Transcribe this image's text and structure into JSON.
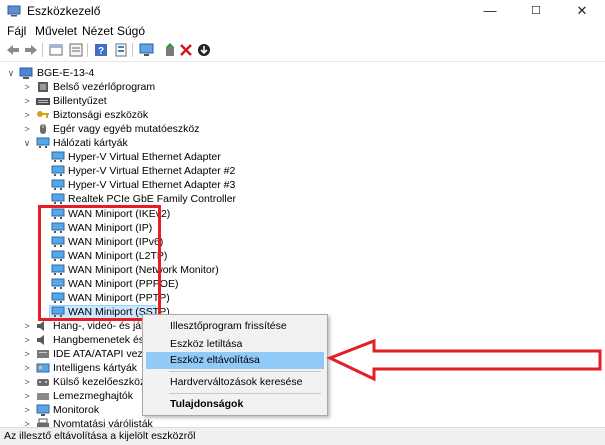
{
  "window": {
    "title": "Eszközkezelő",
    "controls": {
      "minimize": "—",
      "maximize": "☐",
      "close": "✕"
    }
  },
  "menu": [
    "Fájl",
    "Művelet",
    "Nézet",
    "Súgó"
  ],
  "toolbar": [
    "back-arrow-icon",
    "forward-arrow-icon",
    "properties-icon",
    "show-hide-icon",
    "help-icon",
    "device-list-icon",
    "monitor-icon",
    "add-driver-icon",
    "remove-x-icon",
    "update-download-icon"
  ],
  "tree": {
    "root": "BGE-E-13-4",
    "items": [
      {
        "label": "Belső vezérlőprogram",
        "expanded": false
      },
      {
        "label": "Billentyűzet",
        "expanded": false
      },
      {
        "label": "Biztonsági eszközök",
        "expanded": false
      },
      {
        "label": "Egér vagy egyéb mutatóeszköz",
        "expanded": false
      },
      {
        "label": "Hálózati kártyák",
        "expanded": true
      },
      {
        "label": "Hyper-V Virtual Ethernet Adapter",
        "child": true
      },
      {
        "label": "Hyper-V Virtual Ethernet Adapter #2",
        "child": true
      },
      {
        "label": "Hyper-V Virtual Ethernet Adapter #3",
        "child": true
      },
      {
        "label": "Realtek PCIe GbE Family Controller",
        "child": true
      },
      {
        "label": "WAN Miniport (IKEv2)",
        "child": true
      },
      {
        "label": "WAN Miniport (IP)",
        "child": true
      },
      {
        "label": "WAN Miniport (IPv6)",
        "child": true
      },
      {
        "label": "WAN Miniport (L2TP)",
        "child": true
      },
      {
        "label": "WAN Miniport (Network Monitor)",
        "child": true
      },
      {
        "label": "WAN Miniport (PPPOE)",
        "child": true
      },
      {
        "label": "WAN Miniport (PPTP)",
        "child": true
      },
      {
        "label": "WAN Miniport (SSTP)",
        "child": true,
        "selected": true
      },
      {
        "label": "Hang-, videó- és ják",
        "expanded": false
      },
      {
        "label": "Hangbemenetek és -k",
        "expanded": false
      },
      {
        "label": "IDE ATA/ATAPI vezérlő",
        "expanded": false
      },
      {
        "label": "Intelligens kártyák",
        "expanded": false
      },
      {
        "label": "Külső kezelőeszközök",
        "expanded": false
      },
      {
        "label": "Lemezmeghajtók",
        "expanded": false
      },
      {
        "label": "Monitorok",
        "expanded": false
      },
      {
        "label": "Nyomtatási várólisták",
        "expanded": false
      }
    ]
  },
  "context_menu": [
    {
      "label": "Illesztőprogram frissítése"
    },
    {
      "label": "Eszköz letiltása"
    },
    {
      "label": "Eszköz eltávolítása",
      "highlighted": true
    },
    {
      "label": "Hardverváltozások keresése"
    },
    {
      "label": "Tulajdonságok",
      "bold": true
    }
  ],
  "status_bar": "Az illesztő eltávolítása a kijelölt eszközről",
  "colors": {
    "highlight": "#cce8ff",
    "ctx_highlight": "#91c9f7",
    "annotation": "#e51d24"
  }
}
